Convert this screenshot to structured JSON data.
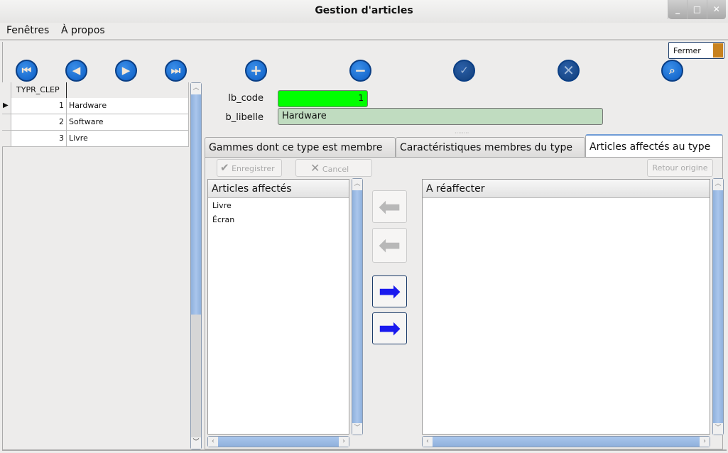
{
  "window": {
    "title": "Gestion d'articles",
    "controls": {
      "minimize": "_",
      "maximize": "□",
      "close": "✕"
    }
  },
  "menu": [
    "Fenêtres",
    "À propos"
  ],
  "toolbar": {
    "fermer": "Fermer"
  },
  "grid": {
    "header": "TYPR_CLEP",
    "rows": [
      {
        "id": "1",
        "label": "Hardware"
      },
      {
        "id": "2",
        "label": "Software"
      },
      {
        "id": "3",
        "label": "Livre"
      }
    ]
  },
  "form": {
    "code_label": "lb_code",
    "code_value": "1",
    "libelle_label": "b_libelle",
    "libelle_value": "Hardware",
    "code_color": "#00ff00",
    "libelle_color": "#c0dcc0"
  },
  "tabs": [
    "Gammes dont ce type est membre",
    "Caractéristiques membres du type",
    "Articles affectés au type"
  ],
  "panel": {
    "save": "Enregistrer",
    "cancel": "Cancel",
    "reset": "Retour origine",
    "left_header": "Articles affectés",
    "left_items": [
      "Livre",
      "Écran"
    ],
    "right_header": "A réaffecter"
  }
}
